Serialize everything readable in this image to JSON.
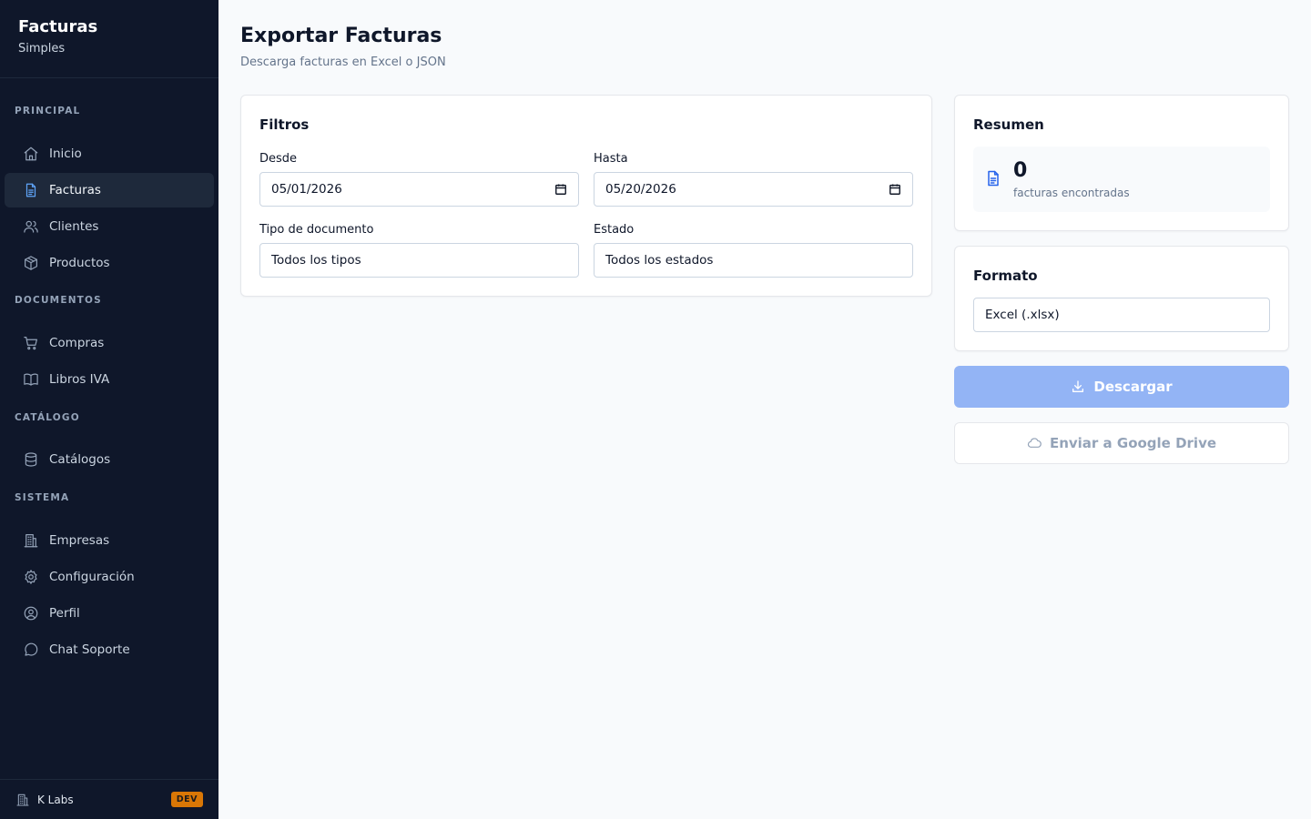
{
  "brand": {
    "title": "Facturas",
    "subtitle": "Simples"
  },
  "sidebar": {
    "sections": [
      {
        "label": "PRINCIPAL",
        "items": [
          {
            "label": "Inicio",
            "icon": "home-icon"
          },
          {
            "label": "Facturas",
            "icon": "file-text-icon",
            "active": true
          },
          {
            "label": "Clientes",
            "icon": "users-icon"
          },
          {
            "label": "Productos",
            "icon": "package-icon"
          }
        ]
      },
      {
        "label": "DOCUMENTOS",
        "items": [
          {
            "label": "Compras",
            "icon": "cart-icon"
          },
          {
            "label": "Libros IVA",
            "icon": "book-icon"
          }
        ]
      },
      {
        "label": "CATÁLOGO",
        "items": [
          {
            "label": "Catálogos",
            "icon": "database-icon"
          }
        ]
      },
      {
        "label": "SISTEMA",
        "items": [
          {
            "label": "Empresas",
            "icon": "building-icon"
          },
          {
            "label": "Configuración",
            "icon": "gear-icon"
          },
          {
            "label": "Perfil",
            "icon": "user-circle-icon"
          },
          {
            "label": "Chat Soporte",
            "icon": "chat-icon"
          }
        ]
      }
    ],
    "footer": {
      "name": "K Labs",
      "badge": "DEV"
    }
  },
  "header": {
    "title": "Exportar Facturas",
    "subtitle": "Descarga facturas en Excel o JSON"
  },
  "filters": {
    "title": "Filtros",
    "desde": {
      "label": "Desde",
      "value": "05/01/2026"
    },
    "hasta": {
      "label": "Hasta",
      "value": "05/20/2026"
    },
    "tipo": {
      "label": "Tipo de documento",
      "value": "Todos los tipos"
    },
    "estado": {
      "label": "Estado",
      "value": "Todos los estados"
    }
  },
  "summary": {
    "title": "Resumen",
    "count": "0",
    "count_label": "facturas encontradas"
  },
  "format": {
    "title": "Formato",
    "value": "Excel (.xlsx)"
  },
  "actions": {
    "download_label": "Descargar",
    "drive_label": "Enviar a Google Drive"
  },
  "colors": {
    "sidebar_bg": "#0f172a",
    "accent": "#2563eb",
    "download_btn": "#93b4f5",
    "dev_badge": "#d97706"
  }
}
